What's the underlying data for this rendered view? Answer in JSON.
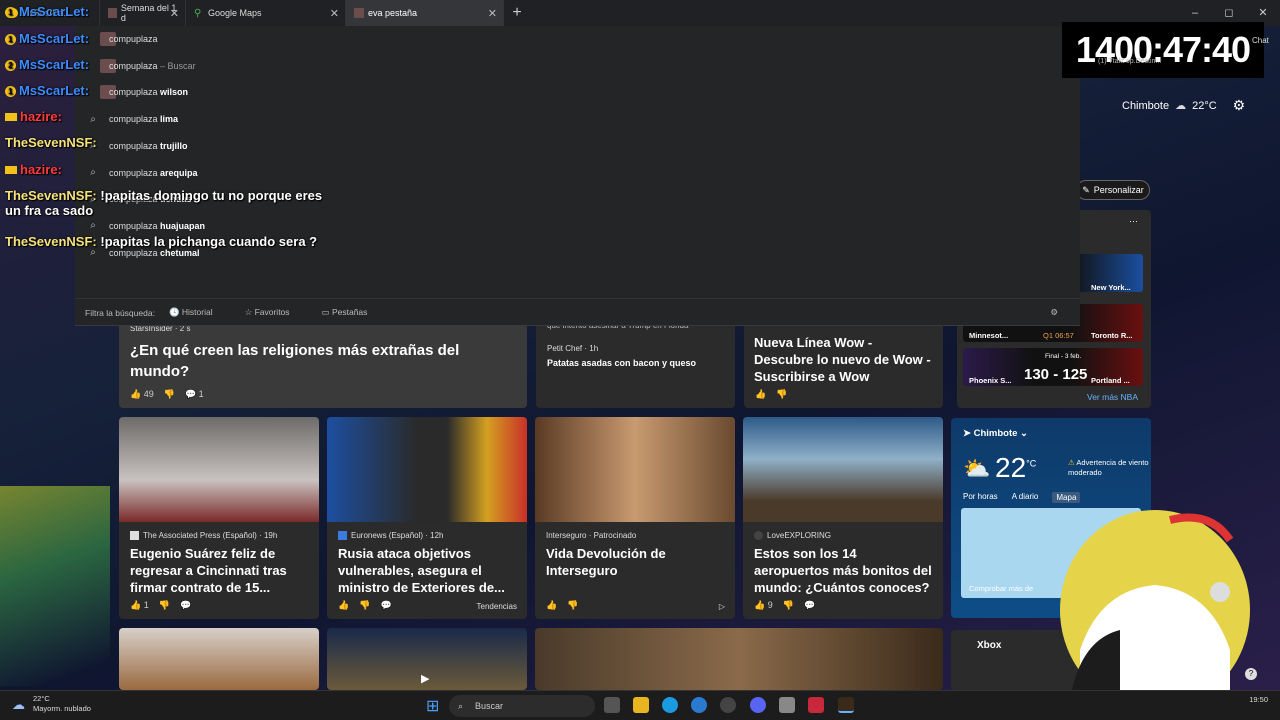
{
  "browser": {
    "tabs": [
      {
        "label": "MsScarLet:",
        "active": false
      },
      {
        "label": "Semana del 1 d",
        "active": false
      },
      {
        "label": "Google Maps",
        "active": false
      },
      {
        "label": "eva pestaña",
        "active": true
      }
    ],
    "new_tab": "+",
    "window_controls": [
      "–",
      "◻",
      "✕"
    ]
  },
  "omnibox_dropdown": {
    "suggestions": [
      {
        "prefix": "",
        "bold": "",
        "rest": "compuplaza",
        "dim": ""
      },
      {
        "prefix": "",
        "bold": "",
        "rest": "compuplaza",
        "dim": "– Buscar"
      },
      {
        "prefix": "",
        "bold": "wilson",
        "rest": "compuplaza ",
        "dim": ""
      },
      {
        "prefix": "",
        "bold": "lima",
        "rest": "compuplaza ",
        "dim": ""
      },
      {
        "prefix": "",
        "bold": "trujillo",
        "rest": "compuplaza ",
        "dim": ""
      },
      {
        "prefix": "",
        "bold": "arequipa",
        "rest": "compuplaza ",
        "dim": ""
      },
      {
        "prefix": "",
        "bold": "tiendas",
        "rest": "compuplaza ",
        "dim": ""
      },
      {
        "prefix": "",
        "bold": "huajuapan",
        "rest": "compuplaza ",
        "dim": ""
      },
      {
        "prefix": "",
        "bold": "chetumal",
        "rest": "compuplaza ",
        "dim": ""
      }
    ],
    "filter_label": "Filtra la búsqueda:",
    "filter_options": [
      "Historial",
      "Favoritos",
      "Pestañas"
    ]
  },
  "stream_overlay": {
    "timer": "1400:47:40",
    "chat_button": "Chat",
    "hint": "(1) Ttakt op.Destin...",
    "chat_messages": [
      {
        "user": "MsScarLet:",
        "text": "",
        "badge": "1",
        "color": "blue"
      },
      {
        "user": "MsScarLet:",
        "text": "",
        "badge": "1",
        "color": "blue"
      },
      {
        "user": "MsScarLet:",
        "text": "",
        "badge": "2",
        "color": "blue"
      },
      {
        "user": "MsScarLet:",
        "text": "",
        "badge": "1",
        "color": "blue"
      },
      {
        "user": "hazire:",
        "text": "",
        "badge": "crown",
        "color": "red"
      },
      {
        "user": "TheSevenNSF:",
        "text": "",
        "badge": "",
        "color": "yellow"
      },
      {
        "user": "hazire:",
        "text": "",
        "badge": "crown",
        "color": "red"
      },
      {
        "user": "TheSevenNSF:",
        "text": "!papitas domingo tu no porque eres un fra ca sado",
        "badge": "",
        "color": "yellow"
      },
      {
        "user": "TheSevenNSF:",
        "text": "!papitas la pichanga cuando sera ?",
        "badge": "",
        "color": "yellow"
      }
    ]
  },
  "page": {
    "city": "Chimbote",
    "city_temp": "22°C",
    "personalize": "Personalizar",
    "cards_top": [
      {
        "source": "StarsInsider · 2 s",
        "title": "¿En qué creen las religiones más extrañas del mundo?",
        "likes": "49",
        "comments": "1"
      },
      {
        "source": "Petit Chef · 1h",
        "title": "Patatas asadas con bacon y queso",
        "top": "que intentó asesinar a Trump en Florida"
      },
      {
        "source": "",
        "title": "Nueva Línea Wow - Descubre lo nuevo de Wow - Suscribirse a Wow"
      }
    ],
    "cards_mid": [
      {
        "source": "The Associated Press (Español) · 19h",
        "title": "Eugenio Suárez feliz de regresar a Cincinnati tras firmar contrato de 15...",
        "likes": "1",
        "trend": ""
      },
      {
        "source": "Euronews (Español) · 12h",
        "title": "Rusia ataca objetivos vulnerables, asegura el ministro de Exteriores de...",
        "likes": "",
        "trend": "Tendencias"
      },
      {
        "source": "Interseguro · Patrocinado",
        "title": "Vida Devolución de Interseguro",
        "likes": "",
        "trend": ""
      },
      {
        "source": "LoveEXPLORING",
        "title": "Estos son los 14 aeropuertos más bonitos del mundo: ¿Cuántos conoces?",
        "likes": "9",
        "trend": ""
      }
    ],
    "nba": {
      "teams": [
        "New York...",
        "Minnesot...",
        "Toronto R...",
        "Phoenix S...",
        "Portland ..."
      ],
      "quarter": "Q1 06:57",
      "final": "Final - 3 feb.",
      "score": "130 - 125",
      "more": "Ver más NBA"
    },
    "weather": {
      "city": "Chimbote",
      "temp": "22",
      "unit": "°C",
      "warning": "Advertencia de viento moderado",
      "tabs": [
        "Por horas",
        "A diario",
        "Mapa"
      ],
      "compare": "Comprobar más de"
    },
    "xbox": "Xbox"
  },
  "taskbar": {
    "weather_temp": "22°C",
    "weather_desc": "Mayorm. nublado",
    "search": "Buscar",
    "clock": "19:50"
  }
}
